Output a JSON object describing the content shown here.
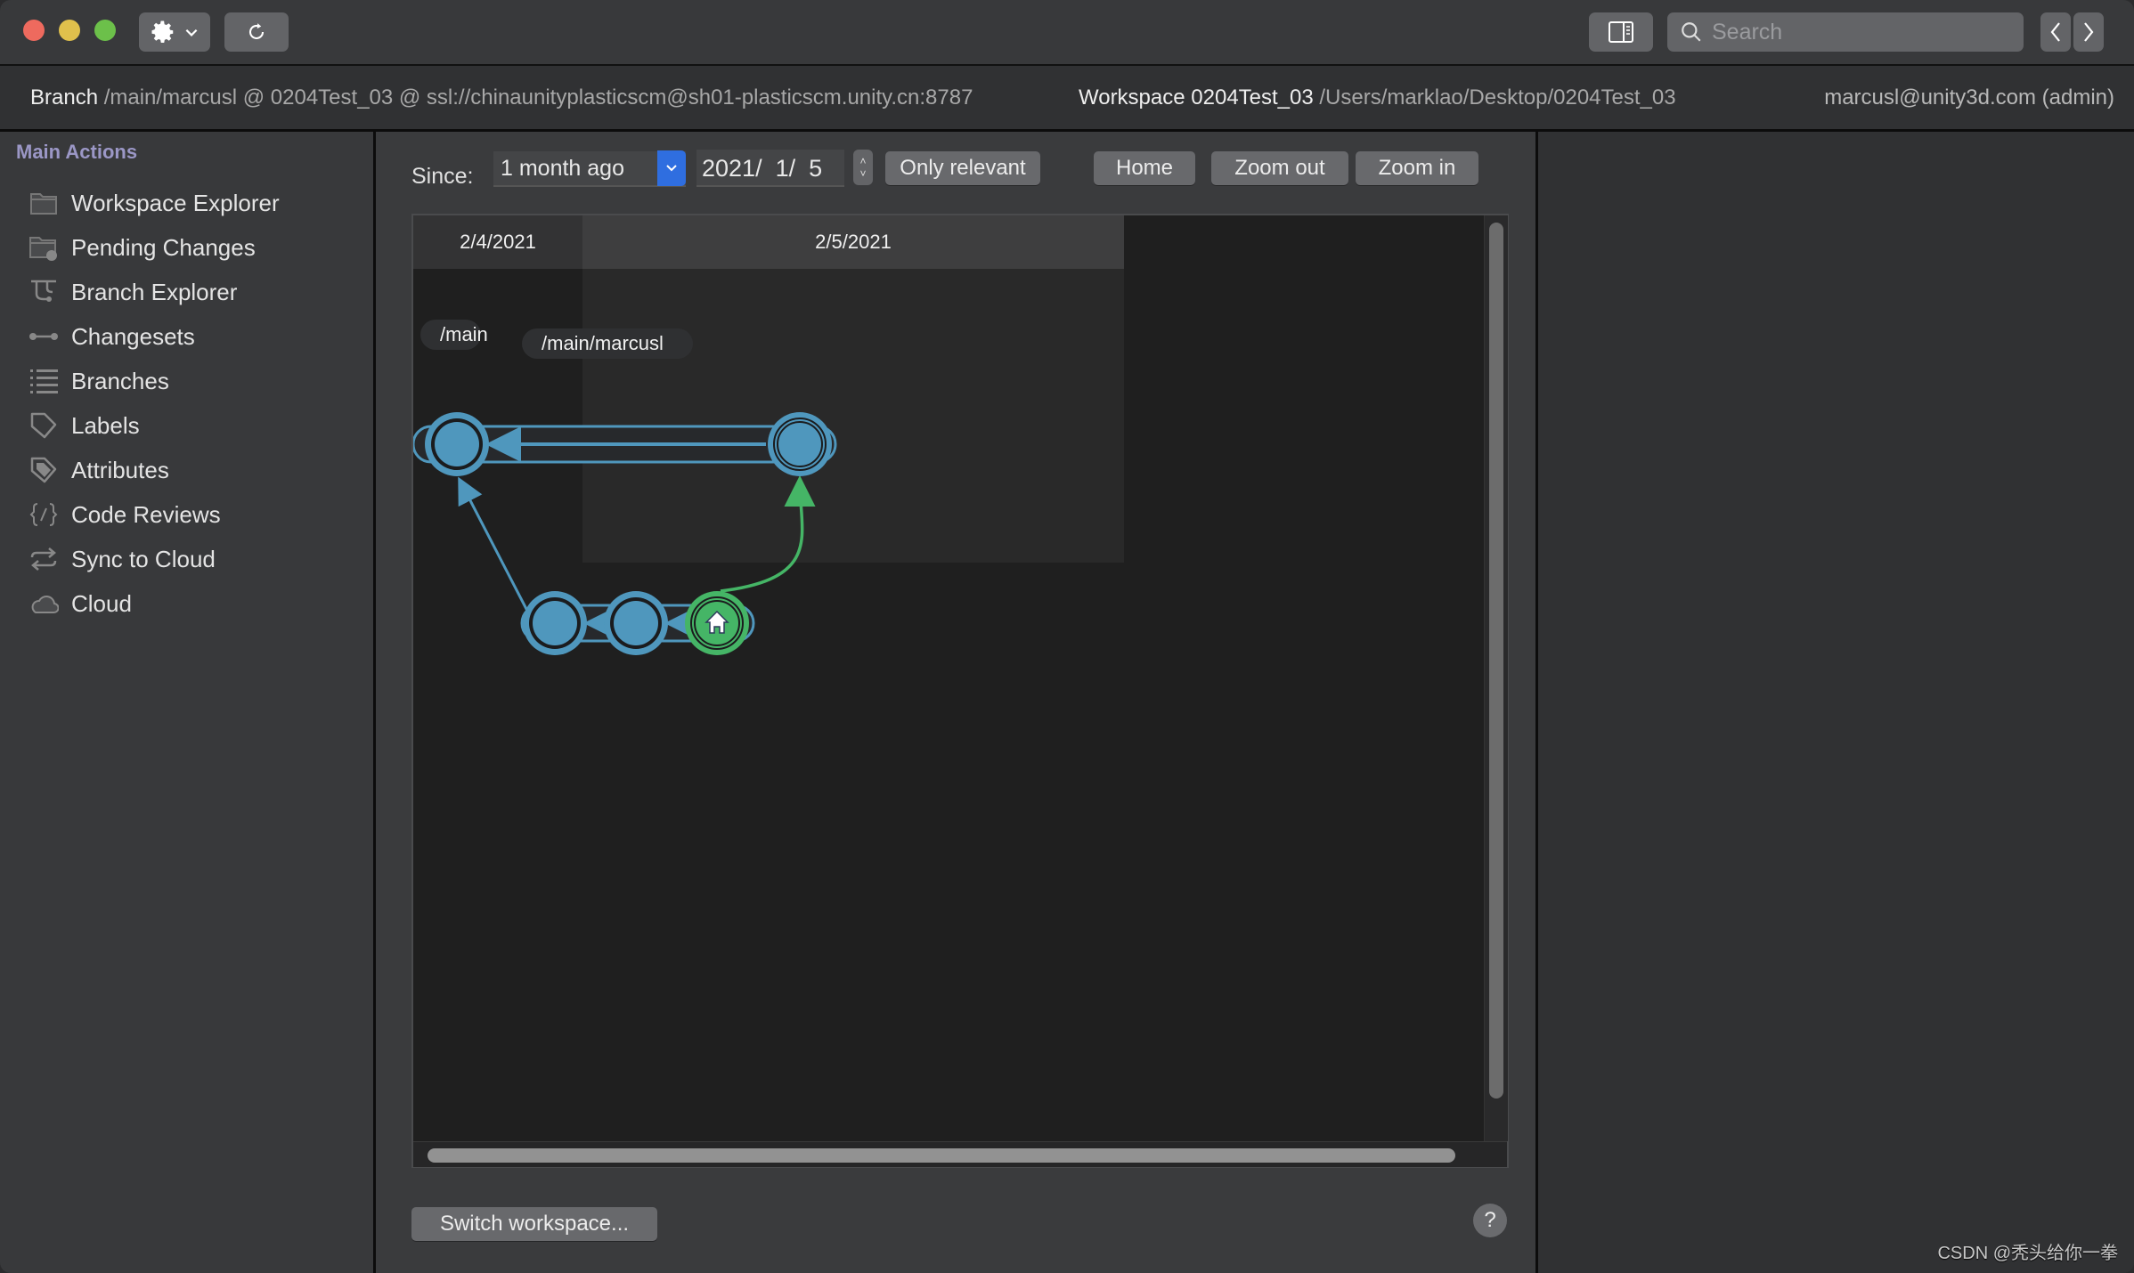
{
  "titlebar": {
    "gear_icon": "gear-icon",
    "refresh_icon": "refresh-icon",
    "sidebar_toggle_icon": "sidebar-toggle-icon",
    "search_placeholder": "Search",
    "nav_back_icon": "chevron-left-icon",
    "nav_forward_icon": "chevron-right-icon"
  },
  "infobar": {
    "branch_label": "Branch",
    "branch_value": "/main/marcusl @ 0204Test_03 @ ssl://chinaunityplasticscm@sh01-plasticscm.unity.cn:8787",
    "workspace_label": "Workspace 0204Test_03",
    "workspace_path": "/Users/marklao/Desktop/0204Test_03",
    "user": "marcusl@unity3d.com (admin)"
  },
  "sidebar": {
    "heading": "Main Actions",
    "items": [
      {
        "label": "Workspace Explorer",
        "icon": "folder-icon"
      },
      {
        "label": "Pending Changes",
        "icon": "pending-changes-icon"
      },
      {
        "label": "Branch Explorer",
        "icon": "branch-explorer-icon"
      },
      {
        "label": "Changesets",
        "icon": "changesets-icon"
      },
      {
        "label": "Branches",
        "icon": "list-icon"
      },
      {
        "label": "Labels",
        "icon": "tag-icon"
      },
      {
        "label": "Attributes",
        "icon": "attribute-tag-icon"
      },
      {
        "label": "Code Reviews",
        "icon": "code-review-icon"
      },
      {
        "label": "Sync to Cloud",
        "icon": "sync-icon"
      },
      {
        "label": "Cloud",
        "icon": "cloud-icon"
      }
    ]
  },
  "toolbar": {
    "since_label": "Since:",
    "since_value": "1 month ago",
    "date_value": "2021/  1/  5",
    "only_relevant": "Only relevant",
    "home": "Home",
    "zoom_out": "Zoom out",
    "zoom_in": "Zoom in"
  },
  "graph": {
    "date_columns": [
      "2/4/2021",
      "2/5/2021"
    ],
    "branches": [
      {
        "name": "/main",
        "color": "#4f97bd"
      },
      {
        "name": "/main/marcusl",
        "color": "#4f97bd"
      }
    ],
    "changesets": [
      {
        "branch": "/main",
        "column": 0,
        "type": "normal"
      },
      {
        "branch": "/main",
        "column": 1,
        "type": "merge-target"
      },
      {
        "branch": "/main/marcusl",
        "column": 1,
        "type": "normal"
      },
      {
        "branch": "/main/marcusl",
        "column": 1,
        "type": "normal"
      },
      {
        "branch": "/main/marcusl",
        "column": 1,
        "type": "workspace-home"
      }
    ],
    "merge_color": "#45b566",
    "node_color": "#4f97bd"
  },
  "footer": {
    "switch_workspace": "Switch workspace...",
    "help": "?"
  },
  "watermark": "CSDN @秃头给你一拳"
}
